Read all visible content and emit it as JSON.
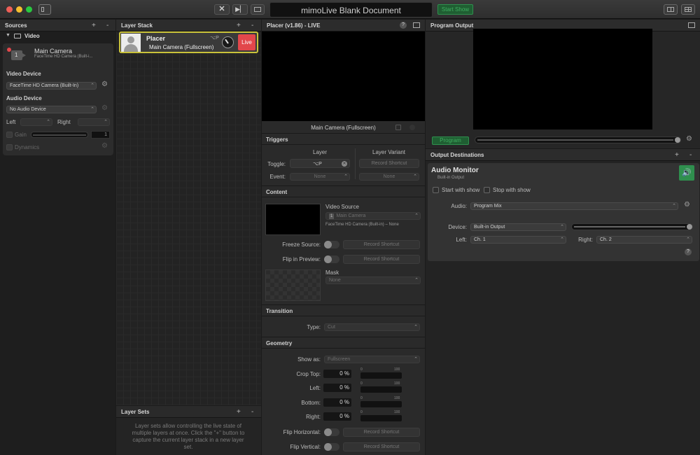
{
  "window": {
    "title": "mimoLive Blank Document",
    "start_show_label": "Start Show"
  },
  "sources": {
    "header": "Sources",
    "group": "Video",
    "item": {
      "name": "Main Camera",
      "subtitle": "FaceTime HD Camera (Built-i...",
      "badge": "1"
    },
    "video_device_label": "Video Device",
    "video_device_value": "FaceTime HD Camera (Built-In)",
    "audio_device_label": "Audio Device",
    "audio_device_value": "No Audio Device",
    "left_label": "Left",
    "right_label": "Right",
    "gain_label": "Gain",
    "gain_value": "1",
    "dynamics_label": "Dynamics"
  },
  "layer_stack": {
    "header": "Layer Stack",
    "layer": {
      "name": "Placer",
      "subtitle": "Main Camera (Fullscreen)",
      "shortcut": "⌥P",
      "live_label": "Live"
    }
  },
  "layer_sets": {
    "header": "Layer Sets",
    "help": "Layer sets allow controlling the live state of multiple layers at once. Click the \"+\" button to capture the current layer stack in a new layer set."
  },
  "inspector": {
    "header": "Placer (v1.86) - LIVE",
    "preview_caption": "Main Camera (Fullscreen)",
    "triggers": {
      "title": "Triggers",
      "col_layer": "Layer",
      "col_variant": "Layer Variant",
      "toggle_label": "Toggle:",
      "toggle_value": "⌥P",
      "record_shortcut": "Record Shortcut",
      "event_label": "Event:",
      "event_value": "None",
      "variant_event_value": "None"
    },
    "content": {
      "title": "Content",
      "video_source_label": "Video Source",
      "video_source_value": "Main Camera",
      "video_source_badge": "1",
      "video_source_detail": "FaceTime HD Camera (Built-in) – None",
      "freeze_label": "Freeze Source:",
      "flip_preview_label": "Flip in Preview:",
      "record_shortcut": "Record Shortcut",
      "mask_label": "Mask",
      "mask_value": "None"
    },
    "transition": {
      "title": "Transition",
      "type_label": "Type:",
      "type_value": "Cut"
    },
    "geometry": {
      "title": "Geometry",
      "show_as_label": "Show as:",
      "show_as_value": "Fullscreen",
      "crop_top_label": "Crop Top:",
      "left_label": "Left:",
      "bottom_label": "Bottom:",
      "right_label": "Right:",
      "crop_top_value": "0 %",
      "left_value": "0 %",
      "bottom_value": "0 %",
      "right_value": "0 %",
      "tick_min": "0",
      "tick_max": "100",
      "flip_h_label": "Flip Horizontal:",
      "flip_v_label": "Flip Vertical:",
      "record_shortcut": "Record Shortcut"
    }
  },
  "program_output": {
    "header": "Program Output",
    "program_button": "Program"
  },
  "output_destinations": {
    "header": "Output Destinations",
    "audio_monitor": {
      "title": "Audio Monitor",
      "subtitle": "Built-in Output",
      "start_with_show": "Start with show",
      "stop_with_show": "Stop with show",
      "audio_label": "Audio:",
      "audio_value": "Program Mix",
      "device_label": "Device:",
      "device_value": "Built-in Output",
      "left_label": "Left:",
      "left_value": "Ch. 1",
      "right_label": "Right:",
      "right_value": "Ch. 2"
    }
  },
  "colors": {
    "live": "#e2474b",
    "accent_green": "#2f8f4e",
    "layer_border": "#c9c23a"
  }
}
